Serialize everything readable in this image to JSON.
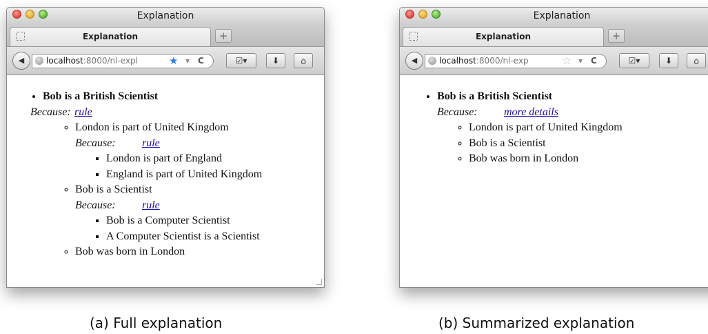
{
  "windows": [
    {
      "title": "Explanation",
      "tab_label": "Explanation",
      "newtab_label": "+",
      "url_host": "localhost",
      "url_rest": ":8000/nl-expl",
      "bookmark_star": "★",
      "reload": "C",
      "tree": {
        "statement": "Bob is a British Scientist",
        "because_label": "Because:",
        "link_label": "rule",
        "children": [
          {
            "text": "London is part of United Kingdom",
            "because_label": "Because:",
            "link_label": "rule",
            "children": [
              "London is part of England",
              "England is part of United Kingdom"
            ]
          },
          {
            "text": "Bob is a Scientist",
            "because_label": "Because:",
            "link_label": "rule",
            "children": [
              "Bob is a Computer Scientist",
              "A Computer Scientist is a Scientist"
            ]
          },
          {
            "text": "Bob was born in London"
          }
        ]
      }
    },
    {
      "title": "Explanation",
      "tab_label": "Explanation",
      "newtab_label": "+",
      "url_host": "localhost",
      "url_rest": ":8000/nl-exp",
      "bookmark_star": "☆",
      "reload": "C",
      "tree": {
        "statement": "Bob is a British Scientist",
        "because_label": "Because:",
        "link_label": "more details",
        "children": [
          {
            "text": "London is part of United Kingdom"
          },
          {
            "text": "Bob is a Scientist"
          },
          {
            "text": "Bob was born in London"
          }
        ]
      }
    }
  ],
  "captions": {
    "a": "(a) Full explanation",
    "b": "(b) Summarized explanation"
  },
  "colors": {
    "link": "#1a0dab",
    "star_filled": "#2c7be5",
    "light_red": "#e0443a",
    "light_yellow": "#e7a92b",
    "light_green": "#5cb536"
  }
}
